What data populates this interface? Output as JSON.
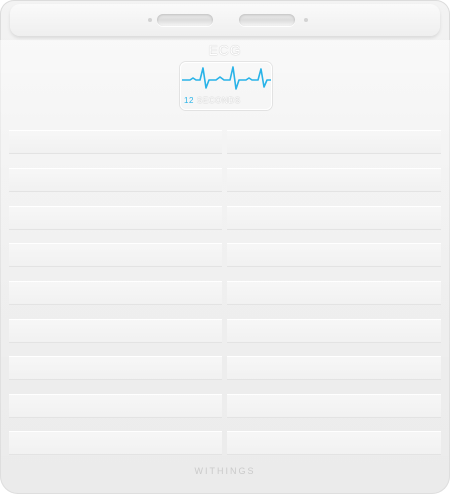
{
  "product": {
    "screen_title": "ECG",
    "ecg_duration_value": "12",
    "ecg_duration_unit": "SECONDS",
    "brand": "WITHINGS"
  },
  "colors": {
    "accent_wave": "#29b3e8",
    "body": "#efefef"
  },
  "icons": {
    "ecg_wave": "ecg-waveform-icon"
  }
}
